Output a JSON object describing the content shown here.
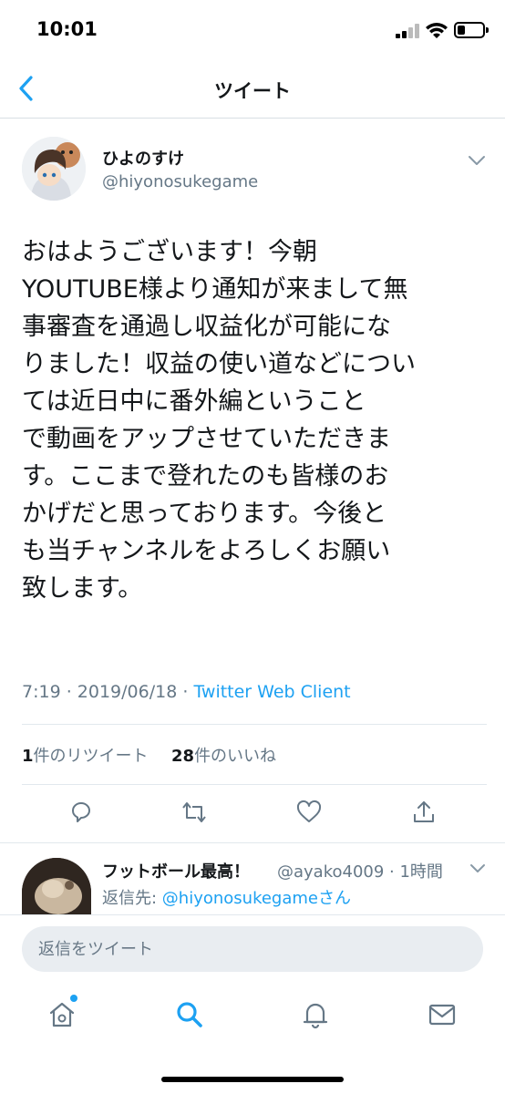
{
  "status_bar": {
    "time": "10:01"
  },
  "nav": {
    "title": "ツイート"
  },
  "tweet": {
    "display_name": "ひよのすけ",
    "handle": "@hiyonosukegame",
    "text": "おはようございます！今朝\nYOUTUBE様より通知が来まして無\n事審査を通過し収益化が可能にな\nりました！収益の使い道などについ\nては近日中に番外編ということ\nで動画をアップさせていただきま\nす。ここまで登れたのも皆様のお\nかげだと思っております。今後と\nも当チャンネルをよろしくお願い\n致します。",
    "time": "7:19",
    "separator": " · ",
    "date": "2019/06/18",
    "client": "Twitter Web Client",
    "retweet_count": "1",
    "retweet_label": "件のリツイート",
    "like_count": "28",
    "like_label": "件のいいね"
  },
  "reply": {
    "name": "フットボール最高！",
    "handle_time": "@ayako4009 · 1時間",
    "reply_prefix": "返信先: ",
    "mention": "@hiyonosukegameさん"
  },
  "compose": {
    "placeholder": "返信をツイート"
  },
  "icons": {
    "back": "chevron-left-icon",
    "caret": "chevron-down-icon",
    "reply": "comment-bubble-icon",
    "retweet": "retweet-icon",
    "like": "heart-icon",
    "share": "share-icon",
    "home": "home-icon",
    "search": "search-icon",
    "notifications": "bell-icon",
    "messages": "mail-icon"
  },
  "colors": {
    "accent": "#1da1f2",
    "secondary_text": "#657786",
    "primary_text": "#14171a"
  }
}
